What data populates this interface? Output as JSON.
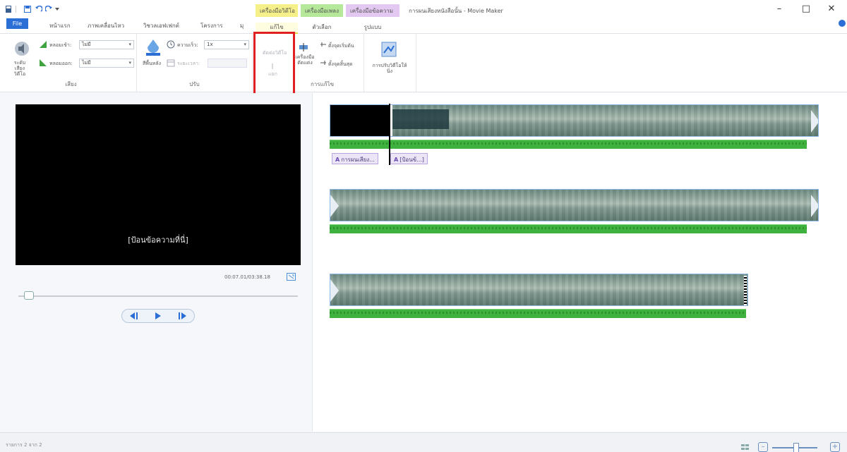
{
  "window": {
    "title": "การผนเสียงหนังสือนั้น - Movie Maker",
    "controls": [
      "–",
      "□",
      "✕"
    ]
  },
  "context_tabs": [
    {
      "label": "เครื่องมือวิดีโอ",
      "color": "#f5f08a",
      "sub": "แก้ไข"
    },
    {
      "label": "เครื่องมือเพลง",
      "color": "#b6e89a",
      "sub": "ตัวเลือก"
    },
    {
      "label": "เครื่องมือข้อความ",
      "color": "#e3c8f1",
      "sub": "รูปแบบ"
    }
  ],
  "tabs": {
    "file": "File",
    "items": [
      "หน้าแรก",
      "ภาพเคลื่อนไหว",
      "วิชวลเอฟเฟกต์",
      "โครงการ",
      "มุ"
    ]
  },
  "ribbon": {
    "audio_group": {
      "label": "เสียง",
      "big_button": "ระดับเสียงวิดีโอ",
      "fade_in_label": "หลอมเข้า:",
      "fade_in_value": "ไม่มี",
      "fade_out_label": "หลอมออก:",
      "fade_out_value": "ไม่มี"
    },
    "adjust_group": {
      "label": "ปรับ",
      "big_button": "สีพื้นหลัง",
      "speed_label": "ความเร็ว:",
      "speed_value": "1x",
      "duration_label": "ระยะเวลา:",
      "duration_value": ""
    },
    "edit_group": {
      "label": "การแก้ไข",
      "disabled_button": "ตัดต่อวิดีโอ",
      "split_label": "แยก",
      "trim_button": "เครื่องมือตัดแต่ง",
      "set_start": "ตั้งจุดเริ่มต้น",
      "set_end": "ตั้งจุดสิ้นสุด"
    },
    "stabilize": {
      "label": "การปรับวิดีโอให้นิ่ง"
    }
  },
  "preview": {
    "caption_text": "[ป้อนข้อความที่นี่]",
    "timecode": "00:07.01/03:38.18",
    "seek_fraction": 0.03
  },
  "timeline": {
    "caption_chips": [
      "การผนเสียง...",
      "[ป้อนข้...]"
    ]
  },
  "status": {
    "text": "รายการ 2 จาก 2"
  },
  "colors": {
    "file_tab": "#2a6ed6",
    "highlight": "#e02020",
    "audio_track": "#3fb13f",
    "caption_chip": "#ece5f8"
  }
}
